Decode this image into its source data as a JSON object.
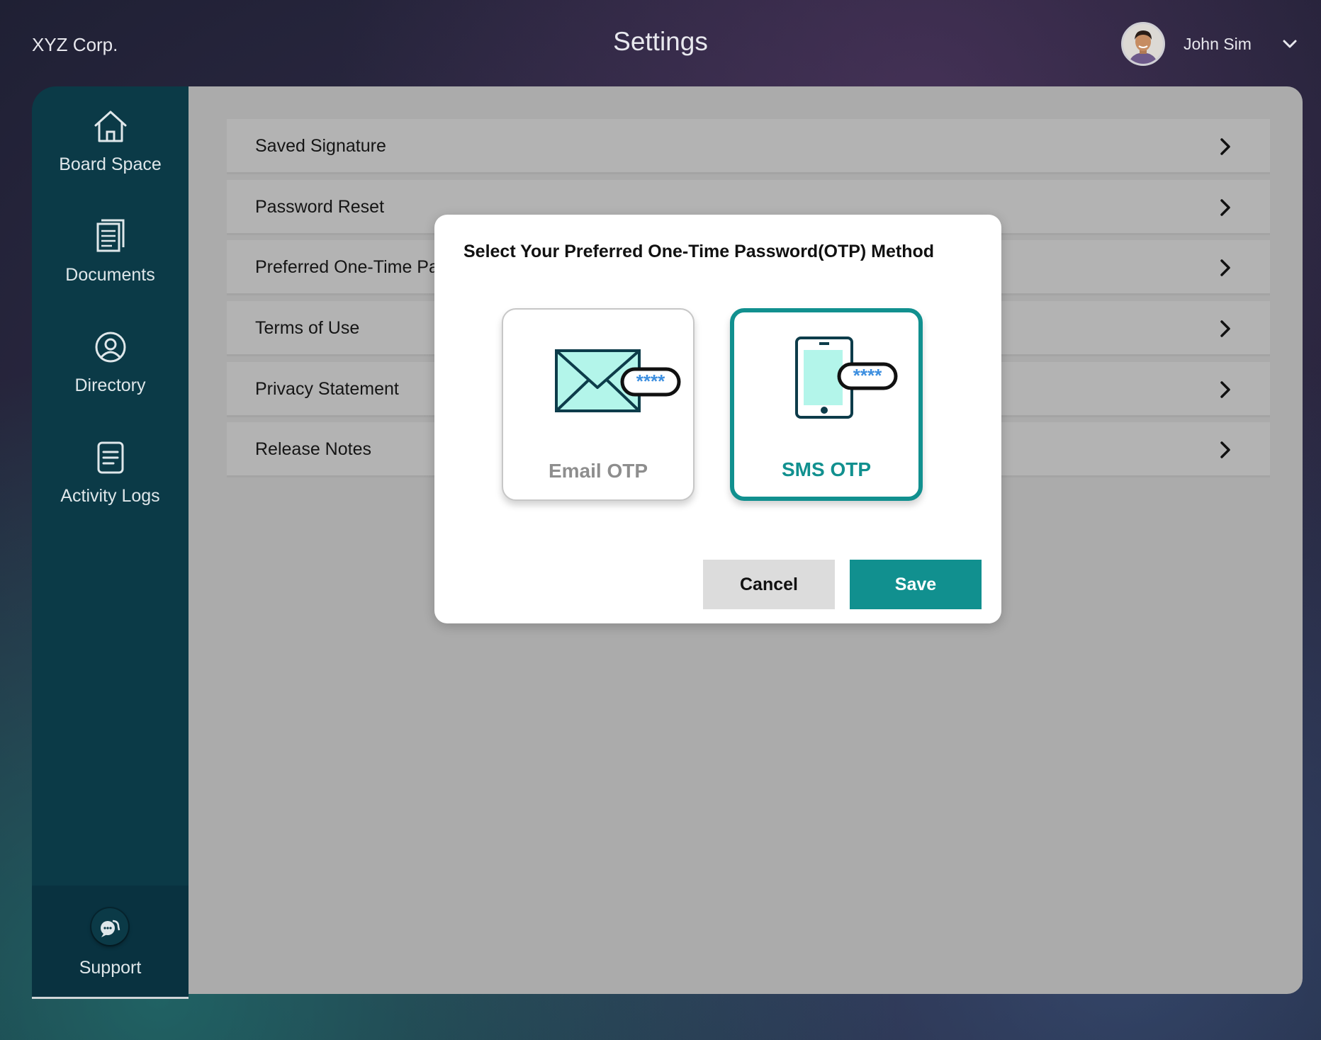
{
  "header": {
    "brand": "XYZ Corp.",
    "title": "Settings",
    "user_name": "John Sim"
  },
  "sidebar": {
    "items": [
      {
        "label": "Board Space",
        "icon": "home-icon"
      },
      {
        "label": "Documents",
        "icon": "documents-icon"
      },
      {
        "label": "Directory",
        "icon": "user-circle-icon"
      },
      {
        "label": "Activity Logs",
        "icon": "list-icon"
      }
    ],
    "support": {
      "label": "Support",
      "icon": "chat-icon"
    }
  },
  "settings": {
    "rows": [
      {
        "label": "Saved Signature"
      },
      {
        "label": "Password Reset"
      },
      {
        "label": "Preferred One-Time Pa"
      },
      {
        "label": "Terms of Use"
      },
      {
        "label": "Privacy Statement"
      },
      {
        "label": "Release Notes"
      }
    ]
  },
  "modal": {
    "title": "Select Your Preferred One-Time Password(OTP) Method",
    "options": [
      {
        "label": "Email OTP",
        "icon": "email-otp-icon",
        "selected": false,
        "mask": "****"
      },
      {
        "label": "SMS OTP",
        "icon": "phone-otp-icon",
        "selected": true,
        "mask": "****"
      }
    ],
    "cancel_label": "Cancel",
    "save_label": "Save"
  },
  "colors": {
    "accent": "#11908f",
    "sidebar": "#0b3a47",
    "overlay_gray": "#ababab"
  }
}
